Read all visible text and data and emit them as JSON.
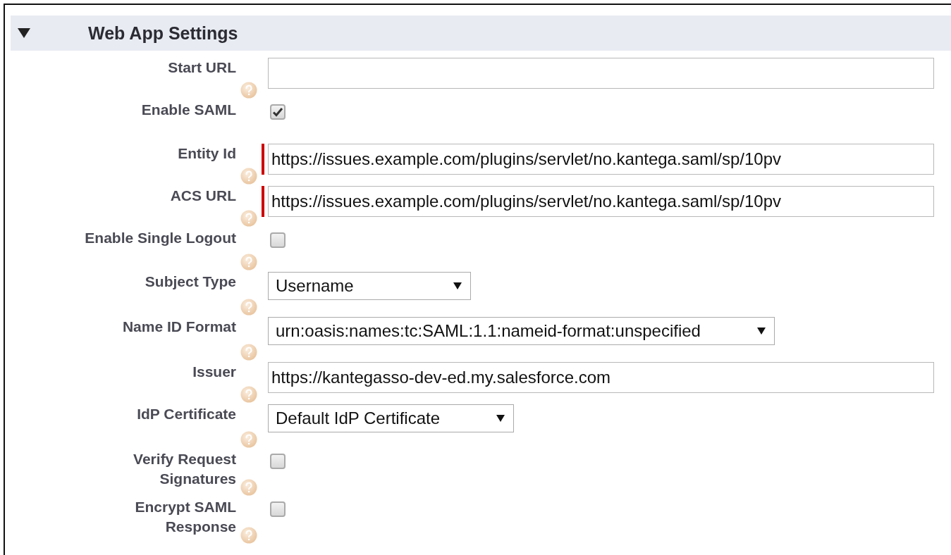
{
  "section": {
    "title": "Web App Settings",
    "expanded": true
  },
  "fields": [
    {
      "kind": "text",
      "label": "Start URL",
      "help": true,
      "required": false
    },
    {
      "kind": "checkbox",
      "label": "Enable SAML",
      "help": false,
      "checked": true
    },
    {
      "kind": "text",
      "label": "Entity Id",
      "help": true,
      "required": true,
      "value": "https://issues.example.com/plugins/servlet/no.kantega.saml/sp/10pv"
    },
    {
      "kind": "text",
      "label": "ACS URL",
      "help": true,
      "required": true,
      "value": "https://issues.example.com/plugins/servlet/no.kantega.saml/sp/10pv"
    },
    {
      "kind": "checkbox",
      "label": "Enable Single Logout",
      "help": true,
      "checked": false
    },
    {
      "kind": "select",
      "label": "Subject Type",
      "help": true,
      "value": "Username"
    },
    {
      "kind": "select",
      "label": "Name ID Format",
      "help": true,
      "value": "urn:oasis:names:tc:SAML:1.1:nameid-format:unspecified"
    },
    {
      "kind": "text",
      "label": "Issuer",
      "help": true,
      "required": false,
      "value": "https://kantegasso-dev-ed.my.salesforce.com"
    },
    {
      "kind": "select",
      "label": "IdP Certificate",
      "help": true,
      "value": "Default IdP Certificate"
    },
    {
      "kind": "checkbox",
      "label": "Verify Request Signatures",
      "help": true,
      "checked": false
    },
    {
      "kind": "checkbox",
      "label": "Encrypt SAML Response",
      "help": true,
      "checked": false
    }
  ]
}
